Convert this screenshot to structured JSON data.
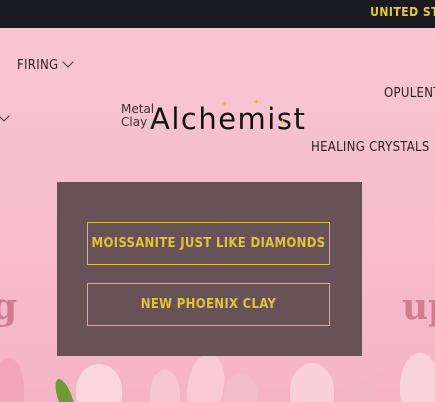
{
  "announcement": {
    "text": "UNITED ST"
  },
  "nav": {
    "firing": "FIRING",
    "opulent": "OPULENT",
    "healing": "HEALING CRYSTALS"
  },
  "logo": {
    "line1": "Metal",
    "line2": "Clay",
    "main": "Alchemist"
  },
  "hero": {
    "left_fragment": "g",
    "right_fragment": "up",
    "cta1": "MOISSANITE JUST LIKE DIAMONDS",
    "cta2": "NEW PHOENIX CLAY"
  },
  "colors": {
    "accent": "#e2c33a",
    "panel": "#685257",
    "topbar": "#1a1b20",
    "background": "#f7bfd0"
  }
}
